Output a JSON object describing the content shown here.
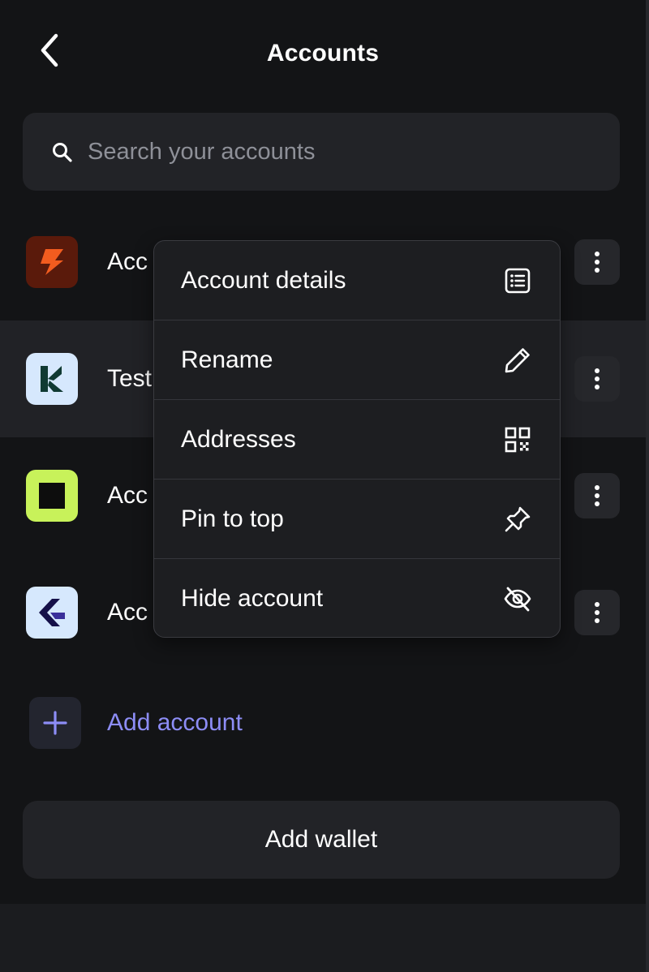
{
  "header": {
    "title": "Accounts"
  },
  "search": {
    "placeholder": "Search your accounts",
    "value": ""
  },
  "accounts": [
    {
      "name": "Acc",
      "logo": "orange-bolt-logo",
      "logo_bg": "#5a1a0b",
      "logo_fg": "#f25c1f"
    },
    {
      "name": "Test",
      "logo": "k-letter-logo",
      "logo_bg": "#d6e8fd",
      "logo_fg": "#103a33",
      "selected": true
    },
    {
      "name": "Acc",
      "logo": "black-square-logo",
      "logo_bg": "#c8f25a",
      "logo_fg": "#0d0d0d"
    },
    {
      "name": "Acc",
      "logo": "navy-chevron-logo",
      "logo_bg": "#d6e8fd",
      "logo_fg": "#151049"
    }
  ],
  "add_account": {
    "label": "Add account",
    "color": "#8d8df6"
  },
  "add_wallet": {
    "label": "Add wallet"
  },
  "context_menu": {
    "items": [
      {
        "label": "Account details",
        "icon": "list-details-icon"
      },
      {
        "label": "Rename",
        "icon": "pencil-icon"
      },
      {
        "label": "Addresses",
        "icon": "qr-code-icon"
      },
      {
        "label": "Pin to top",
        "icon": "pin-icon"
      },
      {
        "label": "Hide account",
        "icon": "eye-off-icon"
      }
    ]
  },
  "colors": {
    "background": "#131416",
    "surface": "#222327",
    "accent": "#8d8df6",
    "menu_bg": "#1d1e21"
  }
}
